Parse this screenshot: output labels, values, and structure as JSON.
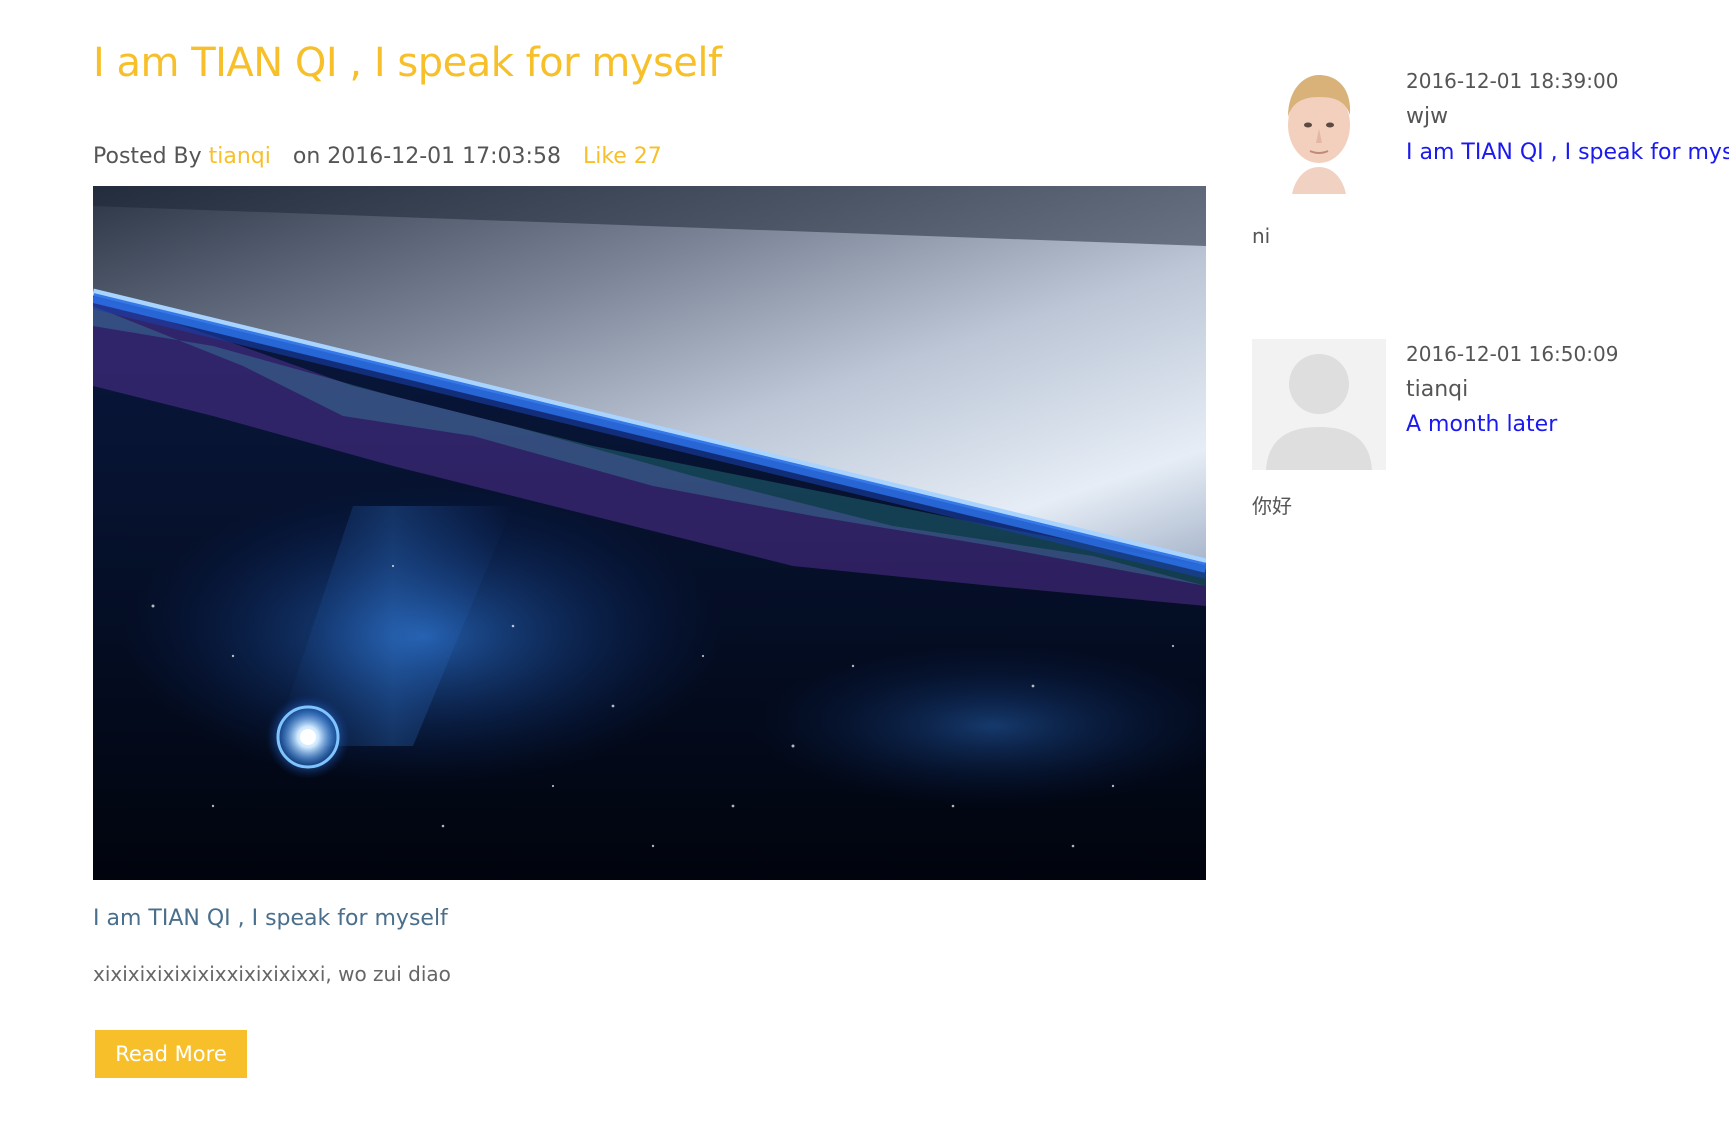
{
  "colors": {
    "accent": "#f7c02a",
    "comment_link": "#1a1af0",
    "excerpt_title": "#4a6f8c",
    "text": "#555555"
  },
  "post": {
    "title": "I am TIAN QI , I speak for myself",
    "meta": {
      "posted_by_label": "Posted By",
      "author": "tianqi",
      "date_label": "on 2016-12-01 17:03:58",
      "like_label": "Like 27"
    },
    "excerpt_title": "I am TIAN QI , I speak for myself",
    "excerpt": "xixixixixixixixxixixixixxi, wo zui diao",
    "read_more_label": "Read More"
  },
  "comments": [
    {
      "avatar": "male-photo-avatar",
      "time": "2016-12-01 18:39:00",
      "user": "wjw",
      "link": "I am TIAN QI , I speak for myse",
      "body": "ni"
    },
    {
      "avatar": "default-user-avatar",
      "time": "2016-12-01 16:50:09",
      "user": "tianqi",
      "link": "A month later",
      "body": "你好"
    }
  ]
}
